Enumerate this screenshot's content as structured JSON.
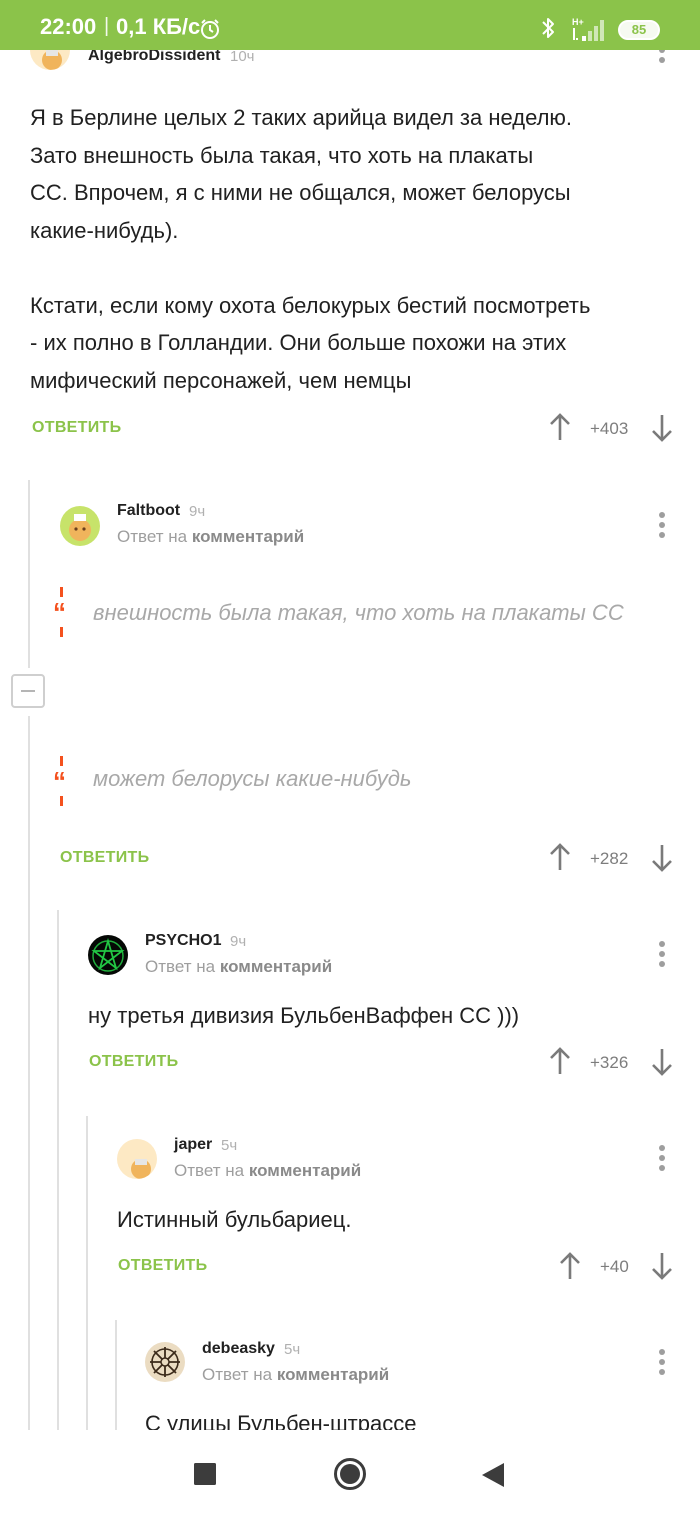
{
  "status_bar": {
    "time": "22:00",
    "separator": "|",
    "speed": "0,1 КБ/с",
    "battery": "85",
    "icons": [
      "alarm-icon",
      "bluetooth-icon",
      "signal-icon",
      "battery-icon"
    ]
  },
  "colors": {
    "accent": "#8bc34a",
    "quote": "#f4511e",
    "text": "#212121",
    "muted": "#9e9e9e"
  },
  "comments": [
    {
      "author": "AlgebroDissident",
      "time": "10ч",
      "paragraphs": [
        [
          "Я в Берлине целых 2 таких арийца видел за неделю.",
          "Зато внешность была такая, что хоть на плакаты",
          "СС. Впрочем, я с ними не общался, может белорусы",
          "какие-нибудь)."
        ],
        [
          "Кстати, если кому охота белокурых бестий посмотреть",
          "- их полно в Голландии. Они больше похожи на этих",
          "мифический персонажей, чем немцы"
        ]
      ],
      "reply_label": "ОТВЕТИТЬ",
      "score": "+403"
    },
    {
      "author": "Faltboot",
      "time": "9ч",
      "reply_prefix": "Ответ на",
      "reply_target": "комментарий",
      "quotes": [
        "внешность была такая, что хоть на плакаты СС",
        "может белорусы какие-нибудь"
      ],
      "reply_label": "ОТВЕТИТЬ",
      "score": "+282"
    },
    {
      "author": "PSYCHO1",
      "time": "9ч",
      "reply_prefix": "Ответ на",
      "reply_target": "комментарий",
      "text": "ну третья дивизия БульбенВаффен СС )))",
      "reply_label": "ОТВЕТИТЬ",
      "score": "+326"
    },
    {
      "author": "japer",
      "time": "5ч",
      "reply_prefix": "Ответ на",
      "reply_target": "комментарий",
      "text": "Истинный бульбариец.",
      "reply_label": "ОТВЕТИТЬ",
      "score": "+40"
    },
    {
      "author": "debeasky",
      "time": "5ч",
      "reply_prefix": "Ответ на",
      "reply_target": "комментарий",
      "text": "С улицы Бульбен-штрассе"
    }
  ],
  "nav": [
    "recents-button",
    "home-button",
    "back-button"
  ]
}
